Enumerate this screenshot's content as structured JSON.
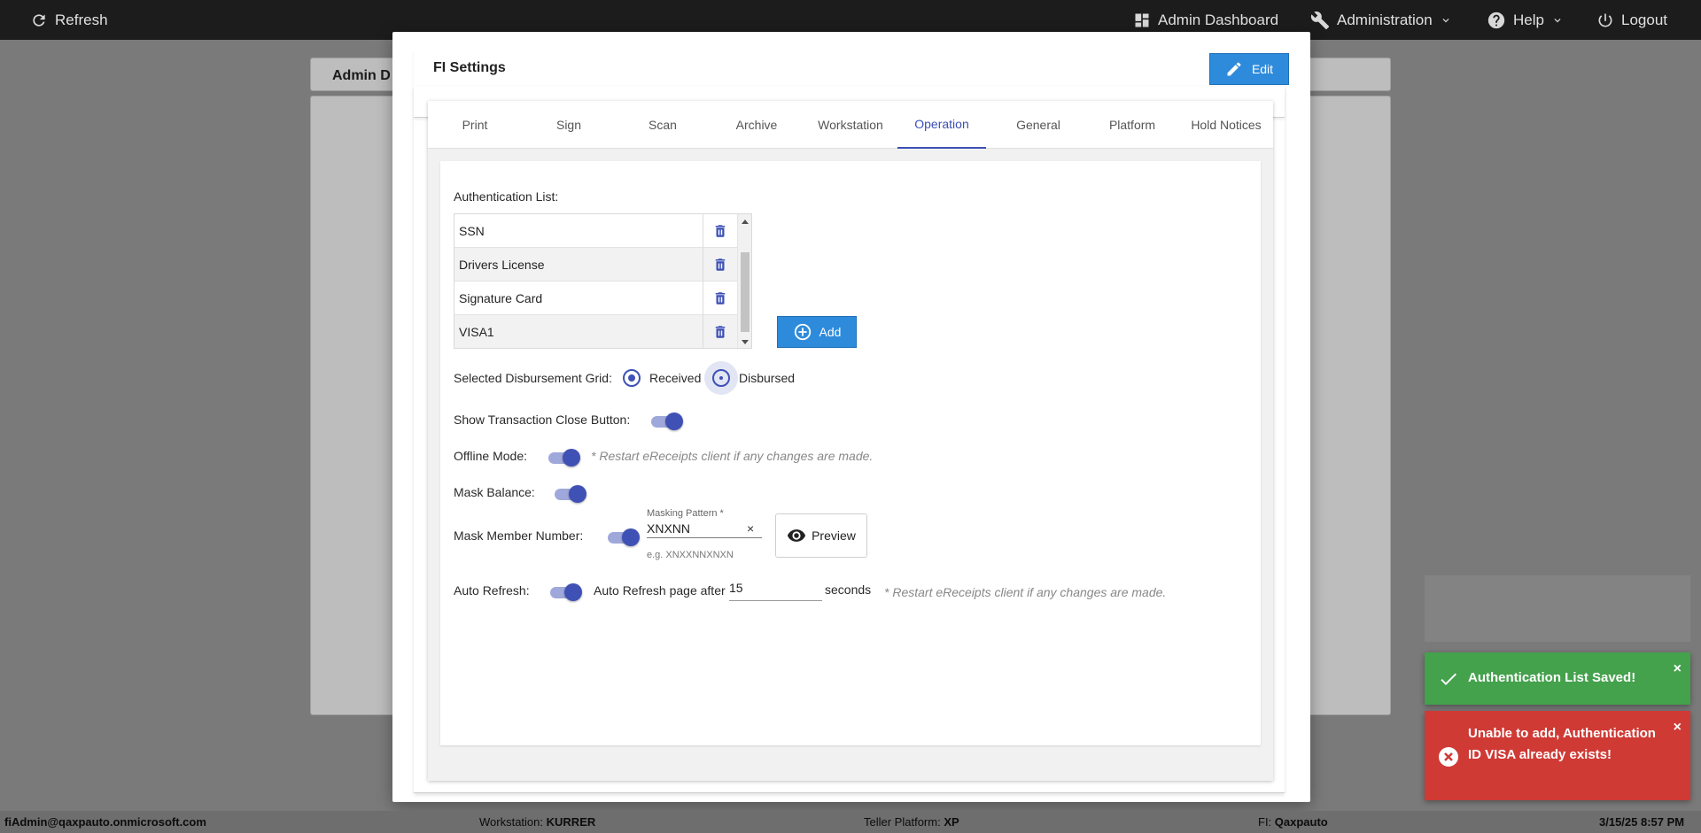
{
  "topbar": {
    "refresh_label": "Refresh",
    "admin_dashboard_label": "Admin Dashboard",
    "administration_label": "Administration",
    "help_label": "Help",
    "logout_label": "Logout"
  },
  "background": {
    "page_title": "Admin D"
  },
  "modal": {
    "title": "FI Settings",
    "edit_label": "Edit",
    "tabs": [
      {
        "label": "Print"
      },
      {
        "label": "Sign"
      },
      {
        "label": "Scan"
      },
      {
        "label": "Archive"
      },
      {
        "label": "Workstation"
      },
      {
        "label": "Operation"
      },
      {
        "label": "General"
      },
      {
        "label": "Platform"
      },
      {
        "label": "Hold Notices"
      }
    ],
    "active_tab": "Operation",
    "operation": {
      "auth_list_label": "Authentication List:",
      "auth_items": [
        {
          "label": "SSN"
        },
        {
          "label": "Drivers License"
        },
        {
          "label": "Signature Card"
        },
        {
          "label": "VISA1"
        }
      ],
      "add_label": "Add",
      "disbursement_label": "Selected Disbursement Grid:",
      "received_label": "Received",
      "disbursed_label": "Disbursed",
      "selected_grid": "Received",
      "show_close_label": "Show Transaction Close Button:",
      "show_close_on": true,
      "offline_label": "Offline Mode:",
      "offline_on": true,
      "offline_note": "* Restart eReceipts client if any changes are made.",
      "mask_balance_label": "Mask Balance:",
      "mask_balance_on": true,
      "mask_member_label": "Mask Member Number:",
      "mask_member_on": true,
      "masking_pattern_label": "Masking Pattern *",
      "masking_pattern_value": "XNXNN",
      "masking_pattern_hint": "e.g. XNXXNNXNXN",
      "clear_symbol": "×",
      "preview_label": "Preview",
      "auto_refresh_label": "Auto Refresh:",
      "auto_refresh_on": true,
      "auto_refresh_page_label": "Auto Refresh page after",
      "auto_refresh_value": "15",
      "seconds_label": "seconds",
      "auto_refresh_note": "* Restart eReceipts client if any changes are made."
    }
  },
  "status_bar": {
    "user": "fiAdmin@qaxpauto.onmicrosoft.com",
    "workstation_label": "Workstation:",
    "workstation_value": "KURRER",
    "teller_label": "Teller Platform:",
    "teller_value": "XP",
    "fi_label": "FI:",
    "fi_value": "Qaxpauto",
    "datetime": "3/15/25 8:57 PM"
  },
  "toasts": {
    "success_message": "Authentication List Saved!",
    "error_message": "Unable to add, Authentication ID VISA already exists!",
    "close_symbol": "×"
  },
  "colors": {
    "primary_blue": "#2e8bdb",
    "indigo": "#3f51b5",
    "success_green": "#44a14c",
    "error_red": "#cf3a35",
    "topbar": "#1c1c1c"
  }
}
